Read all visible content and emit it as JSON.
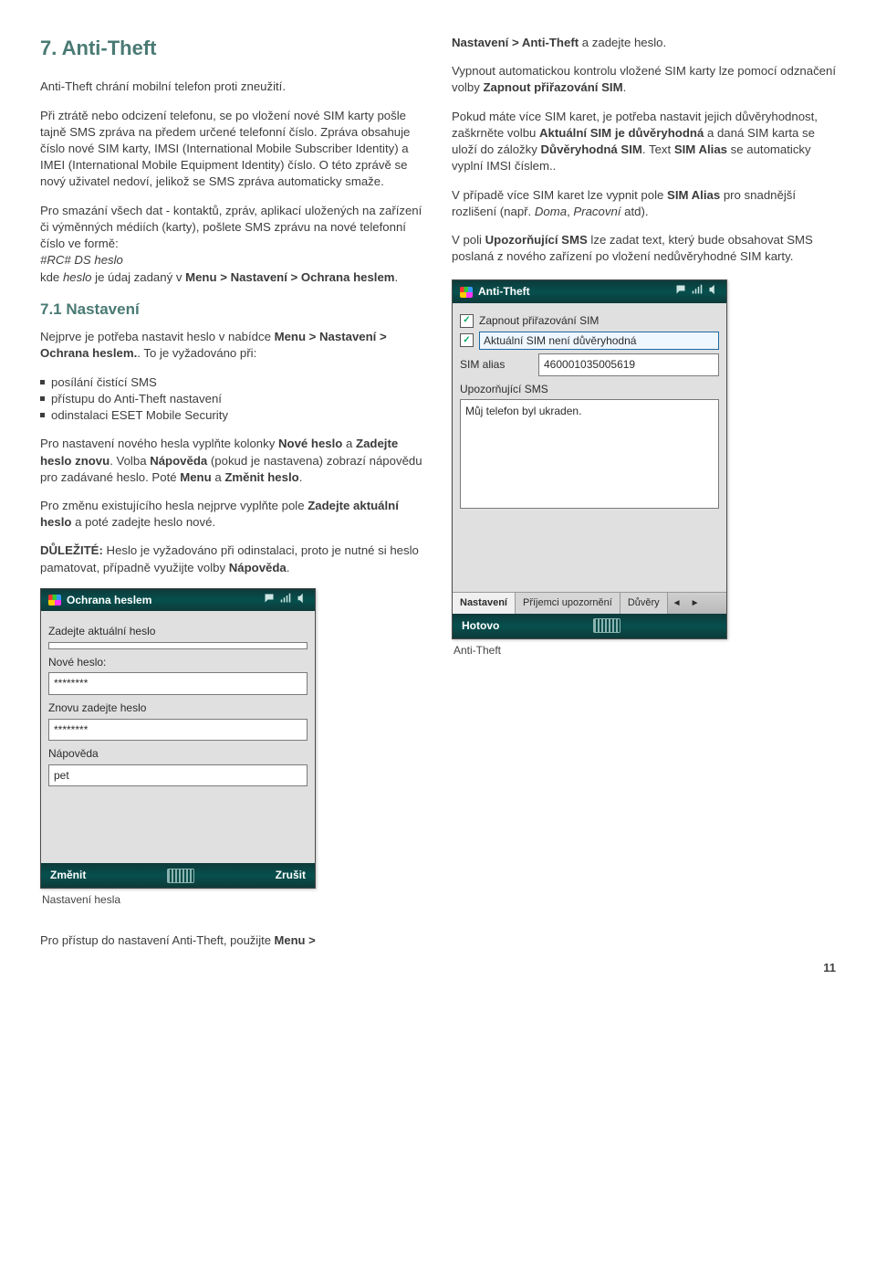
{
  "section": {
    "number": "7.",
    "title": "Anti-Theft"
  },
  "leftCol": {
    "p1": "Anti-Theft chrání mobilní telefon proti zneužití.",
    "p2": "Při ztrátě nebo odcizení telefonu, se po vložení nové SIM karty pošle tajně SMS zpráva na předem určené telefonní číslo. Zpráva obsahuje číslo nové SIM karty, IMSI (International Mobile Subscriber Identity) a IMEI (International Mobile Equipment Identity) číslo. O této zprávě se nový uživatel nedoví, jelikož se SMS zpráva automaticky smaže.",
    "p3_a": "Pro smazání všech dat - kontaktů, zpráv, aplikací uložených na zařízení či výměnných médiích (karty), pošlete SMS zprávu na nové telefonní číslo ve formě:",
    "p3_code": "#RC# DS heslo",
    "p3_b_pre": "kde ",
    "p3_b_em": "heslo",
    "p3_b_mid": " je údaj zadaný v ",
    "p3_b_bold": "Menu > Nastavení > Ochrana heslem",
    "p3_b_end": ".",
    "sub": {
      "number": "7.1",
      "title": "Nastavení"
    },
    "p4_a": "Nejprve je potřeba nastavit heslo v nabídce ",
    "p4_bold": "Menu > Nastavení > Ochrana heslem.",
    "p4_b": ". To je vyžadováno při:",
    "bullets": [
      "posílání čistící SMS",
      "přístupu do Anti-Theft nastavení",
      "odinstalaci ESET Mobile Security"
    ],
    "p5_a": "Pro nastavení nového hesla vyplňte kolonky ",
    "p5_b1": "Nové heslo",
    "p5_mid1": " a ",
    "p5_b2": "Zadejte heslo znovu",
    "p5_mid2": ". Volba ",
    "p5_b3": "Nápověda",
    "p5_mid3": " (pokud je nastavena) zobrazí nápovědu pro zadávané heslo. Poté ",
    "p5_b4": "Menu",
    "p5_mid4": " a ",
    "p5_b5": "Změnit heslo",
    "p5_end": ".",
    "p6_a": "Pro změnu existujícího hesla nejprve vyplňte pole ",
    "p6_b": "Zadejte aktuální heslo",
    "p6_end": " a poté zadejte heslo nové.",
    "p7_b": "DŮLEŽITÉ:",
    "p7_a": " Heslo je vyžadováno při odinstalaci, proto je nutné si heslo pamatovat, případně využijte volby ",
    "p7_b2": "Nápověda",
    "p7_end": "."
  },
  "phone1": {
    "title": "Ochrana heslem",
    "lbl_cur": "Zadejte aktuální heslo",
    "val_cur": "",
    "lbl_new": "Nové heslo:",
    "val_new": "********",
    "lbl_again": "Znovu zadejte heslo",
    "val_again": "********",
    "lbl_hint": "Nápověda",
    "val_hint": "pet",
    "btn_left": "Změnit",
    "btn_right": "Zrušit"
  },
  "caption1": "Nastavení hesla",
  "footerLine_a": "Pro přístup do nastavení Anti-Theft, použijte ",
  "footerLine_b": "Menu >",
  "rightCol": {
    "p0_b": "Nastavení > Anti-Theft",
    "p0_end": " a zadejte heslo.",
    "p1_a": "Vypnout automatickou kontrolu vložené SIM karty lze pomocí odznačení volby ",
    "p1_b": "Zapnout přiřazování SIM",
    "p1_end": ".",
    "p2_a": "Pokud máte více SIM karet, je potřeba nastavit jejich důvěryhodnost, zaškrněte volbu ",
    "p2_b1": "Aktuální SIM je důvěryhodná",
    "p2_mid1": " a daná SIM karta se uloží do záložky ",
    "p2_b2": "Důvěryhodná SIM",
    "p2_mid2": ". Text ",
    "p2_b3": "SIM Alias",
    "p2_end": " se automaticky vyplní IMSI číslem..",
    "p3_a": "V případě více SIM karet lze vypnit pole ",
    "p3_b": "SIM Alias",
    "p3_mid": " pro snadnější rozlišení (např. ",
    "p3_em1": "Doma",
    "p3_sep": ", ",
    "p3_em2": "Pracovní",
    "p3_end": " atd).",
    "p4_a": "V poli ",
    "p4_b": "Upozorňující SMS",
    "p4_end": " lze zadat text, který bude obsahovat SMS poslaná z nového zařízení po vložení nedůvěryhodné SIM karty."
  },
  "phone2": {
    "title": "Anti-Theft",
    "chk1": "Zapnout přiřazování SIM",
    "chk2": "Aktuální SIM není důvěryhodná",
    "lbl_alias": "SIM alias",
    "val_alias": "460001035005619",
    "lbl_sms": "Upozorňující SMS",
    "val_sms": "Můj telefon byl ukraden.",
    "tab1": "Nastavení",
    "tab2": "Příjemci upozornění",
    "tab3": "Důvěry",
    "btn_left": "Hotovo"
  },
  "caption2": "Anti-Theft",
  "pageNumber": "11"
}
